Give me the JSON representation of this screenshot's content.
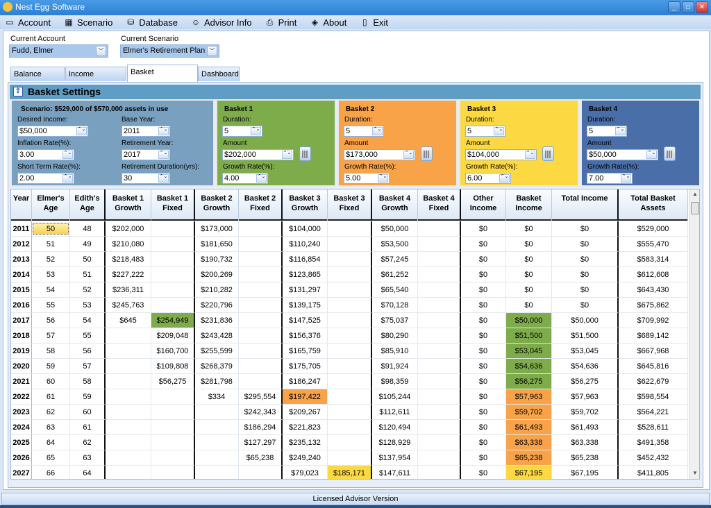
{
  "window": {
    "title": "Nest Egg Software"
  },
  "menu": [
    {
      "label": "Account",
      "icon": "folder-icon"
    },
    {
      "label": "Scenario",
      "icon": "table-icon"
    },
    {
      "label": "Database",
      "icon": "database-icon"
    },
    {
      "label": "Advisor Info",
      "icon": "person-icon"
    },
    {
      "label": "Print",
      "icon": "printer-icon"
    },
    {
      "label": "About",
      "icon": "info-icon"
    },
    {
      "label": "Exit",
      "icon": "door-icon"
    }
  ],
  "account": {
    "label": "Current Account",
    "value": "Fudd, Elmer"
  },
  "scenario": {
    "label": "Current Scenario",
    "value": "Elmer's Retirement Plan"
  },
  "tabs": [
    "Balance Sheet",
    "Income Sources",
    "Basket Illustrations",
    "Dashboard"
  ],
  "active_tab": "Basket Illustrations",
  "settings": {
    "title": "Basket Settings",
    "summary": "Scenario: $529,000 of $570,000 assets in use",
    "desired_income_label": "Desired Income:",
    "desired_income": "$50,000",
    "base_year_label": "Base Year:",
    "base_year": "2011",
    "inflation_label": "Inflation Rate(%):",
    "inflation": "3.00",
    "retirement_year_label": "Retirement Year:",
    "retirement_year": "2017",
    "short_term_label": "Short Term Rate(%):",
    "short_term": "2.00",
    "retirement_duration_label": "Retirement Duration(yrs):",
    "retirement_duration": "30"
  },
  "basket_labels": {
    "duration": "Duration:",
    "amount": "Amount",
    "growth": "Growth Rate(%):"
  },
  "baskets": [
    {
      "name": "Basket 1",
      "duration": "5",
      "amount": "$202,000",
      "growth": "4.00",
      "color": "#7fac4b"
    },
    {
      "name": "Basket 2",
      "duration": "5",
      "amount": "$173,000",
      "growth": "5.00",
      "color": "#f9a349"
    },
    {
      "name": "Basket 3",
      "duration": "5",
      "amount": "$104,000",
      "growth": "6.00",
      "color": "#fcd942"
    },
    {
      "name": "Basket 4",
      "duration": "5",
      "amount": "$50,000",
      "growth": "7.00",
      "color": "#4a6ea8"
    }
  ],
  "table": {
    "columns": [
      "Year",
      "Elmer's Age",
      "Edith's Age",
      "Basket 1 Growth",
      "Basket 1 Fixed",
      "Basket 2 Growth",
      "Basket 2 Fixed",
      "Basket 3 Growth",
      "Basket 3 Fixed",
      "Basket 4 Growth",
      "Basket 4 Fixed",
      "Other Income",
      "Basket Income",
      "Total Income",
      "Total Basket Assets"
    ],
    "rows": [
      [
        "2011",
        "50",
        "48",
        "$202,000",
        "",
        "$173,000",
        "",
        "$104,000",
        "",
        "$50,000",
        "",
        "$0",
        "$0",
        "$0",
        "$529,000"
      ],
      [
        "2012",
        "51",
        "49",
        "$210,080",
        "",
        "$181,650",
        "",
        "$110,240",
        "",
        "$53,500",
        "",
        "$0",
        "$0",
        "$0",
        "$555,470"
      ],
      [
        "2013",
        "52",
        "50",
        "$218,483",
        "",
        "$190,732",
        "",
        "$116,854",
        "",
        "$57,245",
        "",
        "$0",
        "$0",
        "$0",
        "$583,314"
      ],
      [
        "2014",
        "53",
        "51",
        "$227,222",
        "",
        "$200,269",
        "",
        "$123,865",
        "",
        "$61,252",
        "",
        "$0",
        "$0",
        "$0",
        "$612,608"
      ],
      [
        "2015",
        "54",
        "52",
        "$236,311",
        "",
        "$210,282",
        "",
        "$131,297",
        "",
        "$65,540",
        "",
        "$0",
        "$0",
        "$0",
        "$643,430"
      ],
      [
        "2016",
        "55",
        "53",
        "$245,763",
        "",
        "$220,796",
        "",
        "$139,175",
        "",
        "$70,128",
        "",
        "$0",
        "$0",
        "$0",
        "$675,862"
      ],
      [
        "2017",
        "56",
        "54",
        "$645",
        "$254,949",
        "$231,836",
        "",
        "$147,525",
        "",
        "$75,037",
        "",
        "$0",
        "$50,000",
        "$50,000",
        "$709,992"
      ],
      [
        "2018",
        "57",
        "55",
        "",
        "$209,048",
        "$243,428",
        "",
        "$156,376",
        "",
        "$80,290",
        "",
        "$0",
        "$51,500",
        "$51,500",
        "$689,142"
      ],
      [
        "2019",
        "58",
        "56",
        "",
        "$160,700",
        "$255,599",
        "",
        "$165,759",
        "",
        "$85,910",
        "",
        "$0",
        "$53,045",
        "$53,045",
        "$667,968"
      ],
      [
        "2020",
        "59",
        "57",
        "",
        "$109,808",
        "$268,379",
        "",
        "$175,705",
        "",
        "$91,924",
        "",
        "$0",
        "$54,636",
        "$54,636",
        "$645,816"
      ],
      [
        "2021",
        "60",
        "58",
        "",
        "$56,275",
        "$281,798",
        "",
        "$186,247",
        "",
        "$98,359",
        "",
        "$0",
        "$56,275",
        "$56,275",
        "$622,679"
      ],
      [
        "2022",
        "61",
        "59",
        "",
        "",
        "$334",
        "$295,554",
        "$197,422",
        "",
        "$105,244",
        "",
        "$0",
        "$57,963",
        "$57,963",
        "$598,554"
      ],
      [
        "2023",
        "62",
        "60",
        "",
        "",
        "",
        "$242,343",
        "$209,267",
        "",
        "$112,611",
        "",
        "$0",
        "$59,702",
        "$59,702",
        "$564,221"
      ],
      [
        "2024",
        "63",
        "61",
        "",
        "",
        "",
        "$186,294",
        "$221,823",
        "",
        "$120,494",
        "",
        "$0",
        "$61,493",
        "$61,493",
        "$528,611"
      ],
      [
        "2025",
        "64",
        "62",
        "",
        "",
        "",
        "$127,297",
        "$235,132",
        "",
        "$128,929",
        "",
        "$0",
        "$63,338",
        "$63,338",
        "$491,358"
      ],
      [
        "2026",
        "65",
        "63",
        "",
        "",
        "",
        "$65,238",
        "$249,240",
        "",
        "$137,954",
        "",
        "$0",
        "$65,238",
        "$65,238",
        "$452,432"
      ],
      [
        "2027",
        "66",
        "64",
        "",
        "",
        "",
        "",
        "$79,023",
        "$185,171",
        "$147,611",
        "",
        "$0",
        "$67,195",
        "$67,195",
        "$411,805"
      ]
    ]
  },
  "status": "Licensed Advisor Version"
}
